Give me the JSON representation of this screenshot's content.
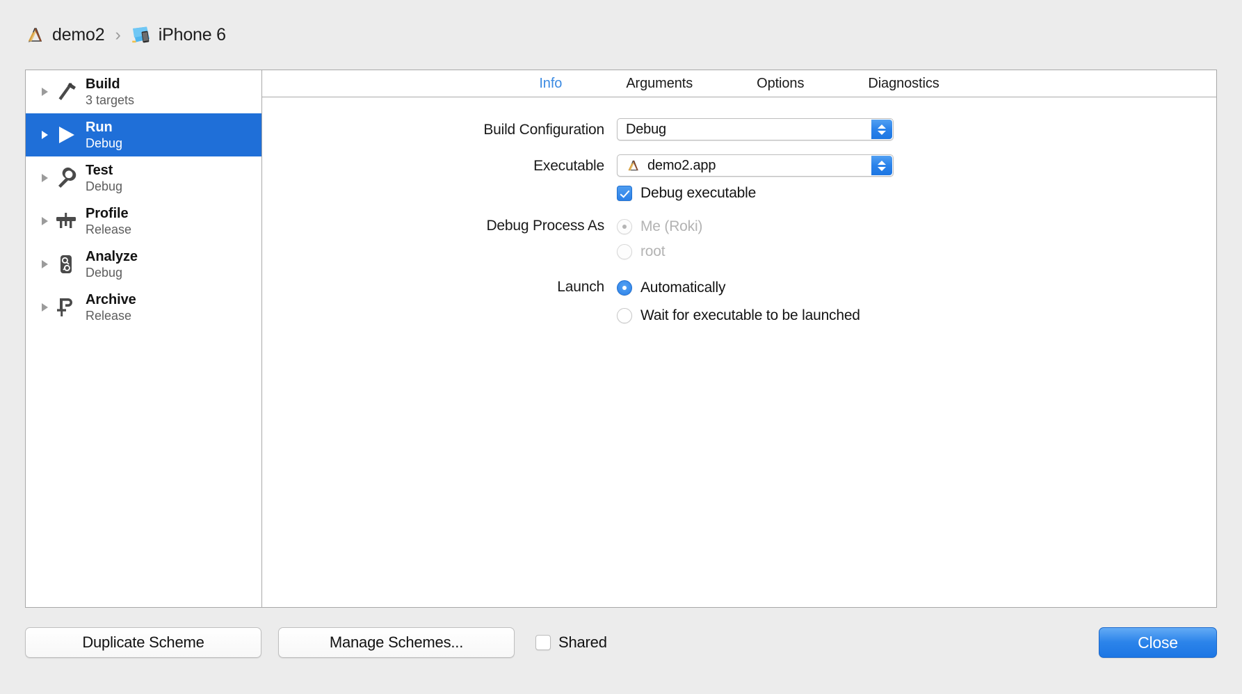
{
  "breadcrumb": {
    "scheme_icon": "xcode-app-icon",
    "scheme": "demo2",
    "separator": "›",
    "destination_icon": "iphone-device-icon",
    "destination": "iPhone 6"
  },
  "colors": {
    "selection_blue": "#1f6fd8",
    "accent_blue": "#2a80e8",
    "tab_active": "#3b8ae2",
    "window_bg": "#ececec",
    "panel_bg": "#ffffff",
    "border": "#a8a8a8",
    "disabled_text": "#b3b3b3"
  },
  "sidebar": {
    "items": [
      {
        "title": "Build",
        "subtitle": "3 targets",
        "icon": "hammer-icon",
        "selected": false,
        "expanded": false
      },
      {
        "title": "Run",
        "subtitle": "Debug",
        "icon": "play-icon",
        "selected": true,
        "expanded": false
      },
      {
        "title": "Test",
        "subtitle": "Debug",
        "icon": "wrench-icon",
        "selected": false,
        "expanded": false
      },
      {
        "title": "Profile",
        "subtitle": "Release",
        "icon": "gauge-icon",
        "selected": false,
        "expanded": false
      },
      {
        "title": "Analyze",
        "subtitle": "Debug",
        "icon": "analyze-icon",
        "selected": false,
        "expanded": false
      },
      {
        "title": "Archive",
        "subtitle": "Release",
        "icon": "clamp-icon",
        "selected": false,
        "expanded": false
      }
    ]
  },
  "tabs": [
    {
      "label": "Info",
      "active": true
    },
    {
      "label": "Arguments",
      "active": false
    },
    {
      "label": "Options",
      "active": false
    },
    {
      "label": "Diagnostics",
      "active": false
    }
  ],
  "form": {
    "build_configuration": {
      "label": "Build Configuration",
      "value": "Debug"
    },
    "executable": {
      "label": "Executable",
      "value": "demo2.app",
      "icon": "xcode-app-icon"
    },
    "debug_executable": {
      "label": "Debug executable",
      "checked": true
    },
    "debug_process_as": {
      "label": "Debug Process As",
      "options": [
        {
          "label": "Me (Roki)",
          "selected": true,
          "disabled": true
        },
        {
          "label": "root",
          "selected": false,
          "disabled": true
        }
      ]
    },
    "launch": {
      "label": "Launch",
      "options": [
        {
          "label": "Automatically",
          "selected": true,
          "disabled": false
        },
        {
          "label": "Wait for executable to be launched",
          "selected": false,
          "disabled": false
        }
      ]
    }
  },
  "bottom_bar": {
    "duplicate_scheme": "Duplicate Scheme",
    "manage_schemes": "Manage Schemes...",
    "shared_label": "Shared",
    "shared_checked": false,
    "close": "Close"
  }
}
